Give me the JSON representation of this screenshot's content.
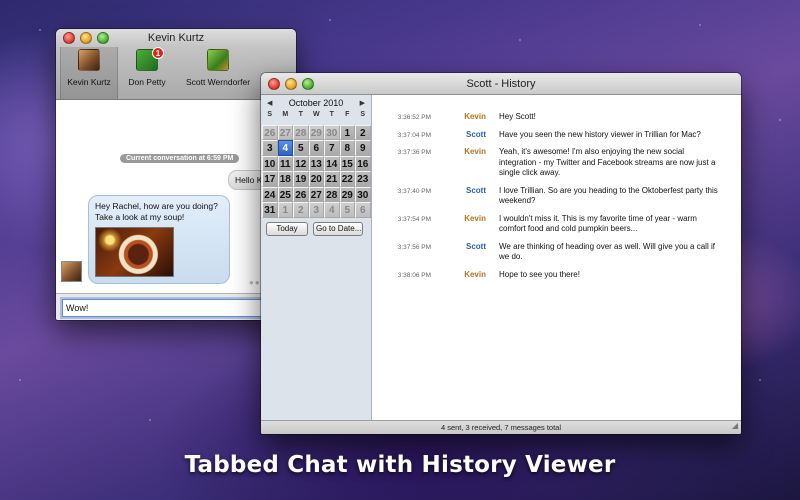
{
  "chat_window": {
    "title": "Kevin Kurtz",
    "tabs": [
      {
        "label": "Kevin Kurtz",
        "badge": ""
      },
      {
        "label": "Don Petty",
        "badge": "1"
      },
      {
        "label": "Scott Werndorfer",
        "badge": ""
      }
    ],
    "timestamp": "Current conversation at 6:59 PM",
    "outgoing_message": "Hello Kevin!",
    "incoming_message": "Hey Rachel, how are you doing? Take a look at my soup!",
    "input_value": "Wow!"
  },
  "history_window": {
    "title": "Scott - History",
    "calendar": {
      "month_label": "October 2010",
      "prev_symbol": "◀",
      "next_symbol": "▶",
      "weekdays": [
        "S",
        "M",
        "T",
        "W",
        "T",
        "F",
        "S"
      ],
      "days": [
        "26",
        "27",
        "28",
        "29",
        "30",
        "1",
        "2",
        "3",
        "4",
        "5",
        "6",
        "7",
        "8",
        "9",
        "10",
        "11",
        "12",
        "13",
        "14",
        "15",
        "16",
        "17",
        "18",
        "19",
        "20",
        "21",
        "22",
        "23",
        "24",
        "25",
        "26",
        "27",
        "28",
        "29",
        "30",
        "31",
        "1",
        "2",
        "3",
        "4",
        "5",
        "6"
      ],
      "selected_day": "4",
      "today_button": "Today",
      "goto_button": "Go to Date..."
    },
    "messages": [
      {
        "time": "3:36:52 PM",
        "sender": "Kevin",
        "text": "Hey Scott!"
      },
      {
        "time": "3:37:04 PM",
        "sender": "Scott",
        "text": "Have you seen the new history viewer in Trillian for Mac?"
      },
      {
        "time": "3:37:36 PM",
        "sender": "Kevin",
        "text": "Yeah, it's awesome! I'm also enjoying the new social integration - my Twitter and Facebook streams are now just a single click away."
      },
      {
        "time": "3:37:40 PM",
        "sender": "Scott",
        "text": "I love Trillian. So are you heading to the Oktoberfest party this weekend?"
      },
      {
        "time": "3:37:54 PM",
        "sender": "Kevin",
        "text": "I wouldn't miss it. This is my favorite time of year - warm comfort food and cold pumpkin beers..."
      },
      {
        "time": "3:37:56 PM",
        "sender": "Scott",
        "text": "We are thinking of heading over as well. Will give you a call if we do."
      },
      {
        "time": "3:38:06 PM",
        "sender": "Kevin",
        "text": "Hope to see you there!"
      }
    ],
    "status": "4 sent, 3 received, 7 messages total"
  },
  "caption": "Tabbed Chat with History Viewer",
  "colors": {
    "kevin": "#b8741f",
    "scott": "#2d5eae",
    "selected_day": "#2d63c9"
  }
}
